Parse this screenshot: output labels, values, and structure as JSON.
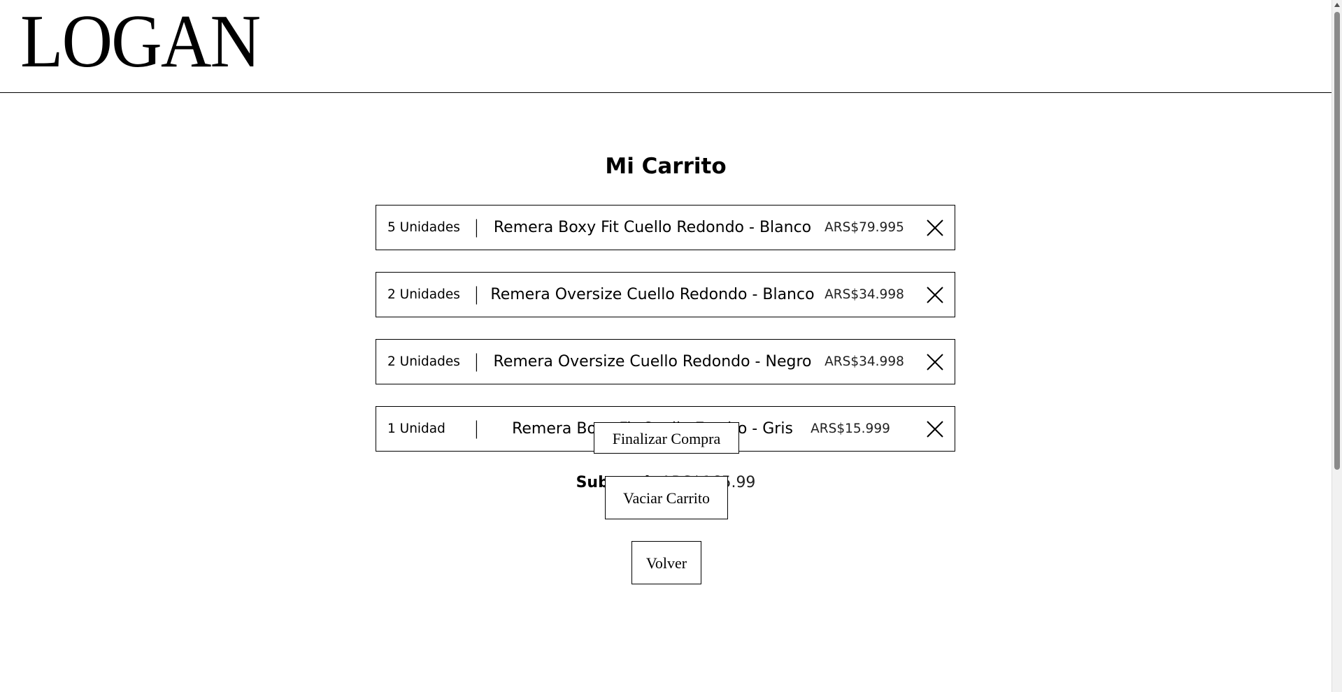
{
  "header": {
    "logo_text": "LOGAN"
  },
  "cart": {
    "title": "Mi Carrito",
    "items": [
      {
        "quantity": "5 Unidades",
        "separator": "|",
        "name": "Remera Boxy Fit Cuello Redondo - Blanco",
        "price": "ARS$79.995",
        "remove_icon": "close-icon"
      },
      {
        "quantity": "2 Unidades",
        "separator": "|",
        "name": "Remera Oversize Cuello Redondo - Blanco",
        "price": "ARS$34.998",
        "remove_icon": "close-icon"
      },
      {
        "quantity": "2 Unidades",
        "separator": "|",
        "name": "Remera Oversize Cuello Redondo - Negro",
        "price": "ARS$34.998",
        "remove_icon": "close-icon"
      },
      {
        "quantity": "1 Unidad",
        "separator": "|",
        "name": "Remera Boxy Fit Cuello Escrito - Gris",
        "price": "ARS$15.999",
        "remove_icon": "close-icon"
      }
    ],
    "subtotal_label": "Subtotal:",
    "subtotal_value": "ARS$165.99"
  },
  "actions": {
    "checkout_label": "Finalizar Compra",
    "empty_cart_label": "Vaciar Carrito",
    "back_label": "Volver"
  },
  "scrollbar": {
    "position_fraction": 0.0
  }
}
